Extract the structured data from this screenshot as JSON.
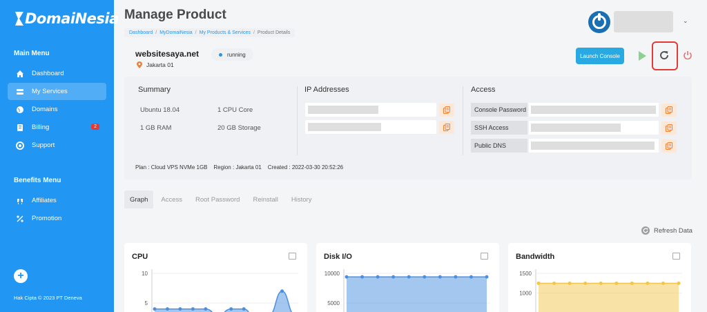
{
  "sidebar": {
    "logo_text": "DomaiNesia",
    "main_menu_title": "Main Menu",
    "main_items": [
      {
        "label": "Dashboard",
        "icon": "home-icon"
      },
      {
        "label": "My Services",
        "icon": "services-icon",
        "active": true
      },
      {
        "label": "Domains",
        "icon": "globe-icon"
      },
      {
        "label": "Billing",
        "icon": "billing-icon",
        "badge": "2"
      },
      {
        "label": "Support",
        "icon": "support-icon"
      }
    ],
    "benefits_title": "Benefits Menu",
    "benefit_items": [
      {
        "label": "Affiliates",
        "icon": "affiliates-icon"
      },
      {
        "label": "Promotion",
        "icon": "promotion-icon"
      }
    ],
    "add_symbol": "+",
    "copyright": "Hak Cipta © 2023  PT Deneva"
  },
  "header": {
    "title": "Manage Product",
    "breadcrumb": [
      "Dashboard",
      "MyDomaiNesia",
      "My Products & Services",
      "Product Details"
    ],
    "user_caret": "⌄"
  },
  "product": {
    "hostname": "websitesaya.net",
    "location": "Jakarta 01",
    "status": "running",
    "launch_label": "Launch Console"
  },
  "summary": {
    "title": "Summary",
    "os": "Ubuntu 18.04",
    "cpu": "1 CPU Core",
    "ram": "1 GB RAM",
    "storage": "20 GB Storage",
    "ip_title": "IP Addresses",
    "access_title": "Access",
    "access_labels": [
      "Console Password",
      "SSH Access",
      "Public DNS"
    ],
    "plan_label": "Plan :",
    "plan_value": "Cloud VPS NVMe 1GB",
    "region_label": "Region :",
    "region_value": "Jakarta 01",
    "created_label": "Created :",
    "created_value": "2022-03-30 20:52:26"
  },
  "tabs": [
    "Graph",
    "Access",
    "Root Password",
    "Reinstall",
    "History"
  ],
  "refresh_label": "Refresh Data",
  "charts": [
    {
      "title": "CPU",
      "ticks": [
        "10",
        "5"
      ]
    },
    {
      "title": "Disk I/O",
      "ticks": [
        "10000",
        "5000"
      ]
    },
    {
      "title": "Bandwidth",
      "ticks": [
        "1500",
        "1000"
      ]
    }
  ],
  "chart_data": [
    {
      "type": "area",
      "title": "CPU",
      "ylim": [
        0,
        10
      ],
      "yticks": [
        10,
        5
      ],
      "series": [
        {
          "values": [
            4,
            4,
            4,
            4,
            4,
            3,
            4,
            4,
            2,
            3,
            7,
            3
          ],
          "color": "#4a90e2"
        }
      ]
    },
    {
      "type": "area",
      "title": "Disk I/O",
      "ylim": [
        0,
        10000
      ],
      "yticks": [
        10000,
        5000
      ],
      "series": [
        {
          "values": [
            9400,
            9400,
            9400,
            9400,
            9400,
            9400,
            9400,
            9400,
            9400,
            9400
          ],
          "color": "#4a90e2"
        }
      ]
    },
    {
      "type": "area",
      "title": "Bandwidth",
      "ylim": [
        0,
        1500
      ],
      "yticks": [
        1500,
        1000
      ],
      "series": [
        {
          "values": [
            1250,
            1250,
            1250,
            1250,
            1250,
            1250,
            1250,
            1250,
            1250,
            1250
          ],
          "color": "#f2c64d"
        }
      ]
    }
  ],
  "colors": {
    "brand": "#2196f3",
    "restart_highlight": "#e53935",
    "copy_icon": "#e8813a"
  }
}
